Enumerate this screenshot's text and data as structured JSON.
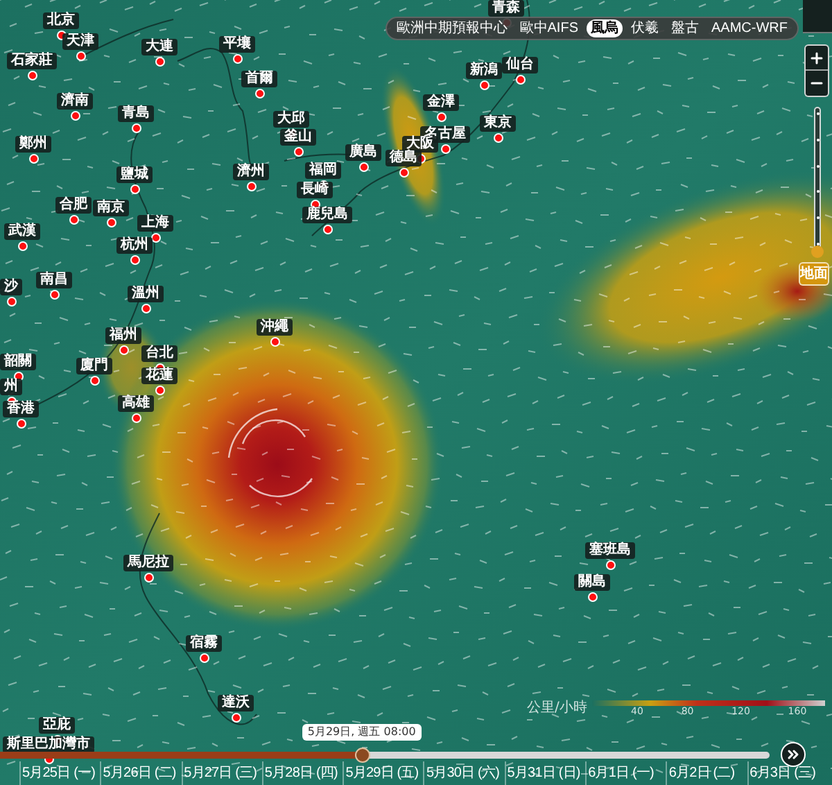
{
  "model_tabs": [
    {
      "label": "歐洲中期預報中心",
      "selected": false
    },
    {
      "label": "歐中AIFS",
      "selected": false
    },
    {
      "label": "風烏",
      "selected": true
    },
    {
      "label": "伏羲",
      "selected": false
    },
    {
      "label": "盤古",
      "selected": false
    },
    {
      "label": "AAMC-WRF",
      "selected": false
    }
  ],
  "level_slider": {
    "level": 0,
    "label": "地面"
  },
  "cities": [
    "青森",
    "北京",
    "天津",
    "大連",
    "平壤",
    "石家莊",
    "新潟",
    "仙台",
    "首爾",
    "濟南",
    "金澤",
    "青島",
    "大邱",
    "東京",
    "名古屋",
    "釜山",
    "鄭州",
    "大阪",
    "廣島",
    "德島",
    "鹽城",
    "濟州",
    "福岡",
    "長崎",
    "合肥",
    "南京",
    "上海",
    "鹿兒島",
    "武漢",
    "杭州",
    "南昌",
    "沙",
    "溫州",
    "沖繩",
    "福州",
    "台北",
    "韶關",
    "廈門",
    "花蓮",
    "州",
    "高雄",
    "香港",
    "塞班島",
    "馬尼拉",
    "關島",
    "宿霧",
    "達沃",
    "亞庇",
    "斯里巴加灣市"
  ],
  "legend": {
    "unit": "公里/小時",
    "ticks": [
      "40",
      "80",
      "120",
      "160"
    ]
  },
  "timeline": {
    "tooltip": "5月29日, 週五 08:00",
    "level": 0.47,
    "days": [
      "5月25日 (一)",
      "5月26日 (二)",
      "5月27日 (三)",
      "5月28日 (四)",
      "5月29日 (五)",
      "5月30日 (六)",
      "5月31日 (日)",
      "6月1日 (一)",
      "6月2日 (二)",
      "6月3日 (三)"
    ]
  }
}
